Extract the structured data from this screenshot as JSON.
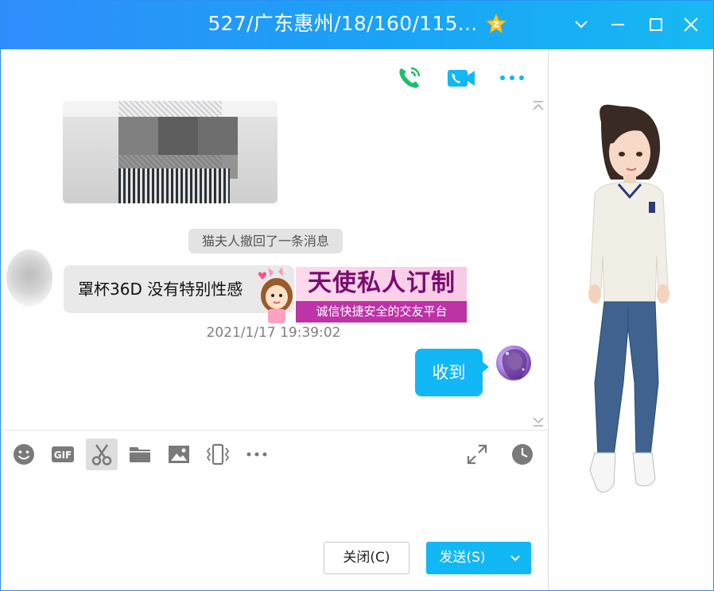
{
  "window": {
    "title": "527/广东惠州/18/160/115...",
    "badge_icon": "vip-star-icon",
    "controls": [
      "minimize-dropdown-icon",
      "minimize-icon",
      "maximize-icon",
      "close-icon"
    ],
    "title_gradient": [
      "#2f8dfb",
      "#17b9f3"
    ]
  },
  "chat_header": {
    "icons": [
      "voice-call-icon",
      "video-call-icon",
      "more-icon"
    ],
    "voice_color": "#1fbf6a",
    "video_color": "#12b7f5",
    "more_color": "#12b7f5"
  },
  "messages": {
    "recall_notice": "猫夫人撤回了一条消息",
    "incoming_text": "罩杯36D 没有特别性感",
    "timestamp": "2021/1/17 19:39:02",
    "outgoing_text": "收到"
  },
  "ad_overlay": {
    "headline": "天使私人订制",
    "tagline": "诚信快捷安全的交友平台"
  },
  "input_toolbar": {
    "tools": [
      "emoji-icon",
      "gif-icon",
      "screenshot-scissors-icon",
      "folder-icon",
      "image-icon",
      "shake-icon",
      "more-icon"
    ],
    "right_tools": [
      "expand-icon",
      "history-clock-icon"
    ],
    "gif_label": "GIF"
  },
  "buttons": {
    "close_label": "关闭(C)",
    "send_label": "发送(S)"
  },
  "colors": {
    "accent": "#12b7f5",
    "bubble_incoming": "#e9e9e9",
    "recall_bg": "#e3e3e3",
    "icon_gray": "#7a7a7a"
  }
}
